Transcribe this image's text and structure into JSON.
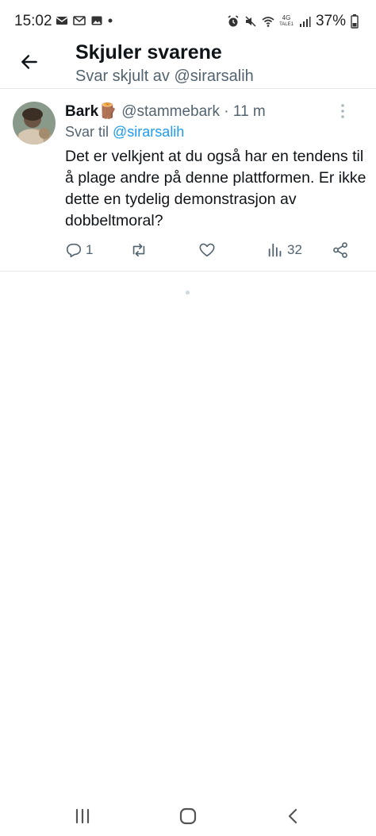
{
  "status_bar": {
    "time": "15:02",
    "battery_percent": "37%",
    "network": "4G",
    "network_sub": "TALE1"
  },
  "header": {
    "title": "Skjuler svarene",
    "subtitle": "Svar skjult av @sirarsalih"
  },
  "tweet": {
    "display_name": "Bark🪵",
    "handle": "@stammebark",
    "separator": "·",
    "time_ago": "11 m",
    "reply_prefix": "Svar til",
    "reply_to_handle": "@sirarsalih",
    "text": "Det er velkjent at du også har en tendens til å plage andre på denne plattformen. Er ikke dette en tydelig demonstrasjon av dobbeltmoral?",
    "reply_count": "1",
    "retweet_count": "",
    "like_count": "",
    "view_count": "32"
  },
  "colors": {
    "accent": "#1d9bf0",
    "secondary_text": "#536471",
    "primary_text": "#0f1419",
    "divider": "#e6e9eb"
  },
  "icons": {
    "back": "arrow-left-icon",
    "more": "more-vertical-icon",
    "reply": "reply-icon",
    "retweet": "retweet-icon",
    "like": "heart-icon",
    "views": "bar-chart-icon",
    "share": "share-icon"
  }
}
